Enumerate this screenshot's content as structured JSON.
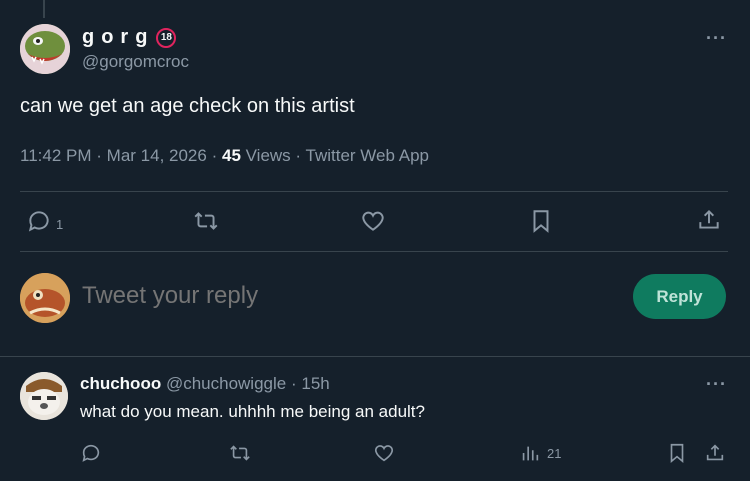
{
  "tweet": {
    "author_name": "gorg",
    "author_badge": "18",
    "author_handle": "@gorgomcroc",
    "text": "can we get an age check on this artist",
    "time": "11:42 PM",
    "date": "Mar 14, 2026",
    "views_count": "45",
    "views_label": "Views",
    "source": "Twitter Web App",
    "reply_count": "1"
  },
  "compose": {
    "placeholder": "Tweet your reply",
    "reply_button": "Reply"
  },
  "comment": {
    "name": "chuchooo",
    "handle": "@chuchowiggle",
    "age": "15h",
    "text": "what do you mean. uhhhh me being an adult?",
    "views": "21"
  },
  "separator_dot": "·",
  "more_glyph": "···",
  "icons": [
    "reply-icon",
    "retweet-icon",
    "like-icon",
    "bookmark-icon",
    "share-icon",
    "views-icon",
    "more-icon"
  ],
  "colors": {
    "background": "#15202b",
    "text": "#f7f9f9",
    "muted": "#8b98a5",
    "divider": "#38444d",
    "reply_button": "#0f7b5f",
    "badge_ring": "#e0245e"
  }
}
